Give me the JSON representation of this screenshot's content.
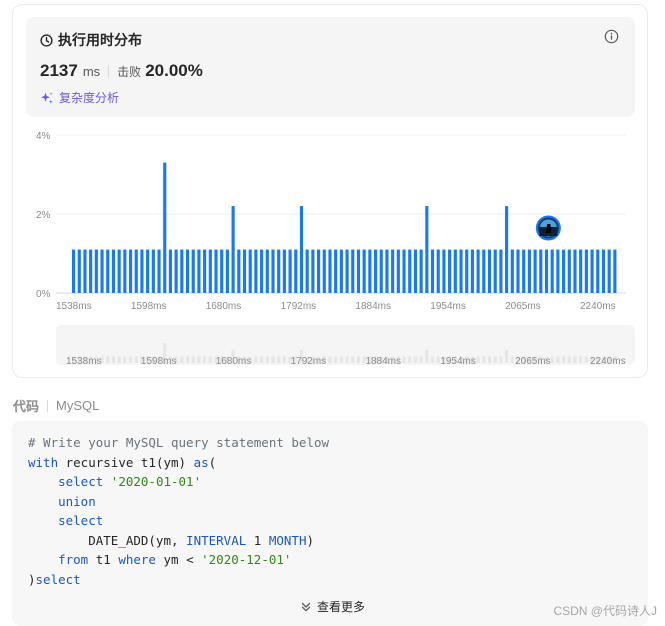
{
  "header": {
    "title": "执行用时分布",
    "runtime_value": "2137",
    "runtime_unit": "ms",
    "beat_label": "击败",
    "beat_value": "20.00%",
    "complexity_link": "复杂度分析"
  },
  "colors": {
    "bar": "#1677ff",
    "accent_purple": "#6b5bd6",
    "mini_bar": "#e6e6e6"
  },
  "chart_data": {
    "type": "bar",
    "title": "",
    "xlabel": "",
    "ylabel": "",
    "ylim": [
      0,
      4
    ],
    "yticks": [
      "4%",
      "2%",
      "0%"
    ],
    "xtick_labels": [
      "1538ms",
      "1598ms",
      "1680ms",
      "1792ms",
      "1884ms",
      "1954ms",
      "2065ms",
      "2240ms"
    ],
    "values": [
      1.1,
      1.1,
      1.1,
      1.1,
      1.1,
      1.1,
      1.1,
      1.1,
      1.1,
      1.1,
      1.1,
      1.1,
      1.1,
      1.1,
      1.1,
      1.1,
      3.3,
      1.1,
      1.1,
      1.1,
      1.1,
      1.1,
      1.1,
      1.1,
      1.1,
      1.1,
      1.1,
      1.1,
      2.2,
      1.1,
      1.1,
      1.1,
      1.1,
      1.1,
      1.1,
      1.1,
      1.1,
      1.1,
      1.1,
      1.1,
      2.2,
      1.1,
      1.1,
      1.1,
      1.1,
      1.1,
      1.1,
      1.1,
      1.1,
      1.1,
      1.1,
      1.1,
      1.1,
      1.1,
      1.1,
      1.1,
      1.1,
      1.1,
      1.1,
      1.1,
      1.1,
      1.1,
      2.2,
      1.1,
      1.1,
      1.1,
      1.1,
      1.1,
      1.1,
      1.1,
      1.1,
      1.1,
      1.1,
      1.1,
      1.1,
      1.1,
      2.2,
      1.1,
      1.1,
      1.1,
      1.1,
      1.1,
      1.1,
      1.1,
      1.1,
      1.1,
      1.1,
      1.1,
      1.1,
      1.1,
      1.1,
      1.1,
      1.1,
      1.1,
      1.1,
      1.1
    ],
    "current_index": 79,
    "grid": true
  },
  "code_section": {
    "label": "代码",
    "language": "MySQL",
    "lines": [
      "# Write your MySQL query statement below",
      "with recursive t1(ym) as(",
      "    select '2020-01-01'",
      "    union",
      "    select",
      "        DATE_ADD(ym, INTERVAL 1 MONTH)",
      "    from t1 where ym < '2020-12-01'",
      ")select"
    ],
    "show_more": "查看更多"
  },
  "watermark": "CSDN @代码诗人J"
}
